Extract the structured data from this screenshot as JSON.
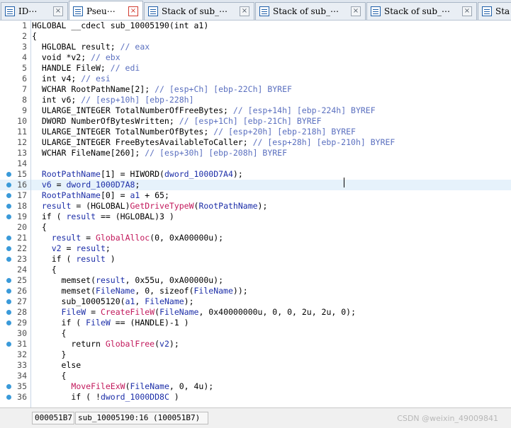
{
  "tabs": [
    {
      "label": "ID⋯",
      "active": false
    },
    {
      "label": "Pseu⋯",
      "active": true
    },
    {
      "label": "Stack of sub_⋯",
      "active": false
    },
    {
      "label": "Stack of sub_⋯",
      "active": false
    },
    {
      "label": "Stack of sub_⋯",
      "active": false
    },
    {
      "label": "Sta",
      "active": false
    }
  ],
  "code_lines": [
    {
      "n": "1",
      "bp": false,
      "hl": false,
      "parts": [
        [
          "pl",
          "HGLOBAL __cdecl sub_10005190(int a1)"
        ]
      ]
    },
    {
      "n": "2",
      "bp": false,
      "hl": false,
      "parts": [
        [
          "pl",
          "{"
        ]
      ]
    },
    {
      "n": "3",
      "bp": false,
      "hl": false,
      "parts": [
        [
          "pl",
          "  HGLOBAL result; "
        ],
        [
          "cm",
          "// eax"
        ]
      ]
    },
    {
      "n": "4",
      "bp": false,
      "hl": false,
      "parts": [
        [
          "pl",
          "  void *v2; "
        ],
        [
          "cm",
          "// ebx"
        ]
      ]
    },
    {
      "n": "5",
      "bp": false,
      "hl": false,
      "parts": [
        [
          "pl",
          "  HANDLE FileW; "
        ],
        [
          "cm",
          "// edi"
        ]
      ]
    },
    {
      "n": "6",
      "bp": false,
      "hl": false,
      "parts": [
        [
          "pl",
          "  int v4; "
        ],
        [
          "cm",
          "// esi"
        ]
      ]
    },
    {
      "n": "7",
      "bp": false,
      "hl": false,
      "parts": [
        [
          "pl",
          "  WCHAR RootPathName[2]; "
        ],
        [
          "cm",
          "// [esp+Ch] [ebp-22Ch] BYREF"
        ]
      ]
    },
    {
      "n": "8",
      "bp": false,
      "hl": false,
      "parts": [
        [
          "pl",
          "  int v6; "
        ],
        [
          "cm",
          "// [esp+10h] [ebp-228h]"
        ]
      ]
    },
    {
      "n": "9",
      "bp": false,
      "hl": false,
      "parts": [
        [
          "pl",
          "  ULARGE_INTEGER TotalNumberOfFreeBytes; "
        ],
        [
          "cm",
          "// [esp+14h] [ebp-224h] BYREF"
        ]
      ]
    },
    {
      "n": "10",
      "bp": false,
      "hl": false,
      "parts": [
        [
          "pl",
          "  DWORD NumberOfBytesWritten; "
        ],
        [
          "cm",
          "// [esp+1Ch] [ebp-21Ch] BYREF"
        ]
      ]
    },
    {
      "n": "11",
      "bp": false,
      "hl": false,
      "parts": [
        [
          "pl",
          "  ULARGE_INTEGER TotalNumberOfBytes; "
        ],
        [
          "cm",
          "// [esp+20h] [ebp-218h] BYREF"
        ]
      ]
    },
    {
      "n": "12",
      "bp": false,
      "hl": false,
      "parts": [
        [
          "pl",
          "  ULARGE_INTEGER FreeBytesAvailableToCaller; "
        ],
        [
          "cm",
          "// [esp+28h] [ebp-210h] BYREF"
        ]
      ]
    },
    {
      "n": "13",
      "bp": false,
      "hl": false,
      "parts": [
        [
          "pl",
          "  WCHAR FileName[260]; "
        ],
        [
          "cm",
          "// [esp+30h] [ebp-208h] BYREF"
        ]
      ]
    },
    {
      "n": "14",
      "bp": false,
      "hl": false,
      "parts": [
        [
          "pl",
          ""
        ]
      ]
    },
    {
      "n": "15",
      "bp": true,
      "hl": false,
      "parts": [
        [
          "pl",
          "  "
        ],
        [
          "var",
          "RootPathName"
        ],
        [
          "pl",
          "[1] = "
        ],
        [
          "pl",
          "HIWORD("
        ],
        [
          "var",
          "dword_1000D7A4"
        ],
        [
          "pl",
          ");"
        ]
      ]
    },
    {
      "n": "16",
      "bp": true,
      "hl": true,
      "parts": [
        [
          "pl",
          "  "
        ],
        [
          "var",
          "v6"
        ],
        [
          "pl",
          " = "
        ],
        [
          "var",
          "dword_1000D7A8"
        ],
        [
          "pl",
          ";"
        ]
      ]
    },
    {
      "n": "17",
      "bp": true,
      "hl": false,
      "parts": [
        [
          "pl",
          "  "
        ],
        [
          "var",
          "RootPathName"
        ],
        [
          "pl",
          "[0] = "
        ],
        [
          "var",
          "a1"
        ],
        [
          "pl",
          " + 65;"
        ]
      ]
    },
    {
      "n": "18",
      "bp": true,
      "hl": false,
      "parts": [
        [
          "pl",
          "  "
        ],
        [
          "var",
          "result"
        ],
        [
          "pl",
          " = (HGLOBAL)"
        ],
        [
          "fn",
          "GetDriveTypeW"
        ],
        [
          "pl",
          "("
        ],
        [
          "var",
          "RootPathName"
        ],
        [
          "pl",
          ");"
        ]
      ]
    },
    {
      "n": "19",
      "bp": true,
      "hl": false,
      "parts": [
        [
          "pl",
          "  if ( "
        ],
        [
          "var",
          "result"
        ],
        [
          "pl",
          " == (HGLOBAL)3 )"
        ]
      ]
    },
    {
      "n": "20",
      "bp": false,
      "hl": false,
      "parts": [
        [
          "pl",
          "  {"
        ]
      ]
    },
    {
      "n": "21",
      "bp": true,
      "hl": false,
      "parts": [
        [
          "pl",
          "    "
        ],
        [
          "var",
          "result"
        ],
        [
          "pl",
          " = "
        ],
        [
          "fn",
          "GlobalAlloc"
        ],
        [
          "pl",
          "(0, 0xA00000u);"
        ]
      ]
    },
    {
      "n": "22",
      "bp": true,
      "hl": false,
      "parts": [
        [
          "pl",
          "    "
        ],
        [
          "var",
          "v2"
        ],
        [
          "pl",
          " = "
        ],
        [
          "var",
          "result"
        ],
        [
          "pl",
          ";"
        ]
      ]
    },
    {
      "n": "23",
      "bp": true,
      "hl": false,
      "parts": [
        [
          "pl",
          "    if ( "
        ],
        [
          "var",
          "result"
        ],
        [
          "pl",
          " )"
        ]
      ]
    },
    {
      "n": "24",
      "bp": false,
      "hl": false,
      "parts": [
        [
          "pl",
          "    {"
        ]
      ]
    },
    {
      "n": "25",
      "bp": true,
      "hl": false,
      "parts": [
        [
          "pl",
          "      memset("
        ],
        [
          "var",
          "result"
        ],
        [
          "pl",
          ", 0x55u, 0xA00000u);"
        ]
      ]
    },
    {
      "n": "26",
      "bp": true,
      "hl": false,
      "parts": [
        [
          "pl",
          "      memset("
        ],
        [
          "var",
          "FileName"
        ],
        [
          "pl",
          ", 0, sizeof("
        ],
        [
          "var",
          "FileName"
        ],
        [
          "pl",
          "));"
        ]
      ]
    },
    {
      "n": "27",
      "bp": true,
      "hl": false,
      "parts": [
        [
          "pl",
          "      sub_10005120("
        ],
        [
          "var",
          "a1"
        ],
        [
          "pl",
          ", "
        ],
        [
          "var",
          "FileName"
        ],
        [
          "pl",
          ");"
        ]
      ]
    },
    {
      "n": "28",
      "bp": true,
      "hl": false,
      "parts": [
        [
          "pl",
          "      "
        ],
        [
          "var",
          "FileW"
        ],
        [
          "pl",
          " = "
        ],
        [
          "fn",
          "CreateFileW"
        ],
        [
          "pl",
          "("
        ],
        [
          "var",
          "FileName"
        ],
        [
          "pl",
          ", 0x40000000u, 0, 0, 2u, 2u, 0);"
        ]
      ]
    },
    {
      "n": "29",
      "bp": true,
      "hl": false,
      "parts": [
        [
          "pl",
          "      if ( "
        ],
        [
          "var",
          "FileW"
        ],
        [
          "pl",
          " == (HANDLE)-1 )"
        ]
      ]
    },
    {
      "n": "30",
      "bp": false,
      "hl": false,
      "parts": [
        [
          "pl",
          "      {"
        ]
      ]
    },
    {
      "n": "31",
      "bp": true,
      "hl": false,
      "parts": [
        [
          "pl",
          "        return "
        ],
        [
          "fn",
          "GlobalFree"
        ],
        [
          "pl",
          "("
        ],
        [
          "var",
          "v2"
        ],
        [
          "pl",
          ");"
        ]
      ]
    },
    {
      "n": "32",
      "bp": false,
      "hl": false,
      "parts": [
        [
          "pl",
          "      }"
        ]
      ]
    },
    {
      "n": "33",
      "bp": false,
      "hl": false,
      "parts": [
        [
          "pl",
          "      else"
        ]
      ]
    },
    {
      "n": "34",
      "bp": false,
      "hl": false,
      "parts": [
        [
          "pl",
          "      {"
        ]
      ]
    },
    {
      "n": "35",
      "bp": true,
      "hl": false,
      "parts": [
        [
          "pl",
          "        "
        ],
        [
          "fn",
          "MoveFileExW"
        ],
        [
          "pl",
          "("
        ],
        [
          "var",
          "FileName"
        ],
        [
          "pl",
          ", 0, 4u);"
        ]
      ]
    },
    {
      "n": "36",
      "bp": true,
      "hl": false,
      "parts": [
        [
          "pl",
          "        if ( !"
        ],
        [
          "var",
          "dword_1000DD8C"
        ],
        [
          "pl",
          " )"
        ]
      ]
    }
  ],
  "status": {
    "address": "000051B7",
    "location": "sub_10005190:16 (100051B7)"
  },
  "watermark": "CSDN @weixin_49009841",
  "colors": {
    "variable": "#1c2ea8",
    "comment": "#5a6fbf",
    "function": "#c2185b",
    "breakpoint": "#3a9ad9",
    "highlight": "#e6f2fb"
  }
}
